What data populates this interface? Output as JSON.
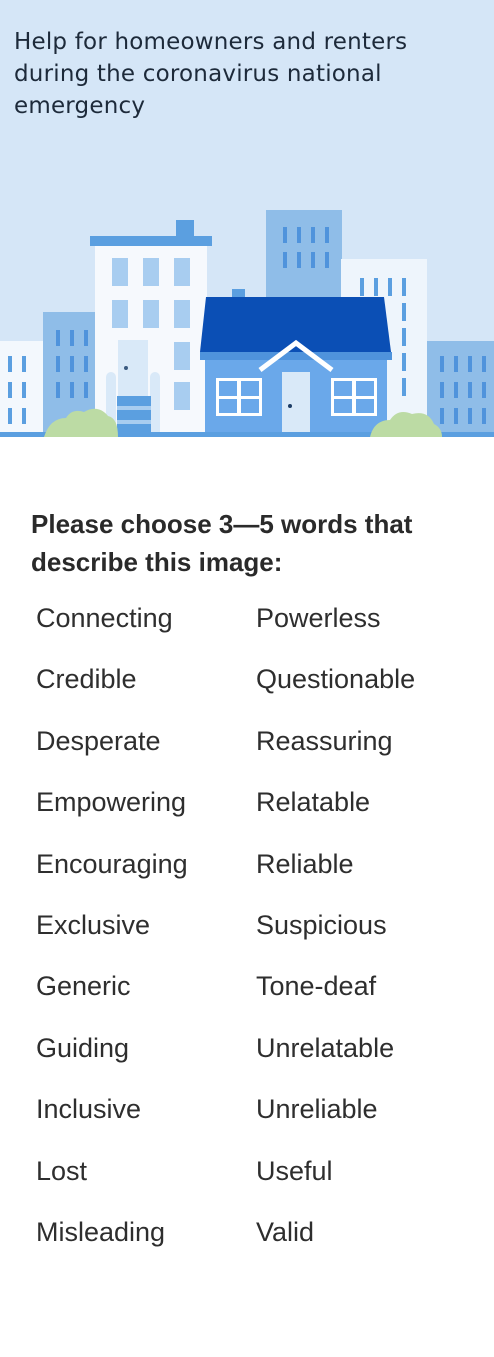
{
  "hero": {
    "caption": "Help for homeowners and renters during the coronavirus national emergency",
    "colors": {
      "sky": "#d5e6f7",
      "building_light": "#8fbde8",
      "building_mid": "#5b9fe0",
      "house_roof": "#0b4fb5",
      "house_body": "#6aa8ea",
      "bush": "#bcdba4"
    }
  },
  "prompt": {
    "text": "Please choose 3—5 words that describe this image:"
  },
  "words": [
    "Connecting",
    "Credible",
    "Desperate",
    "Empowering",
    "Encouraging",
    "Exclusive",
    "Generic",
    "Guiding",
    "Inclusive",
    "Lost",
    "Misleading",
    "Powerless",
    "Questionable",
    "Reassuring",
    "Relatable",
    "Reliable",
    "Suspicious",
    "Tone-deaf",
    "Unrelatable",
    "Unreliable",
    "Useful",
    "Valid"
  ]
}
